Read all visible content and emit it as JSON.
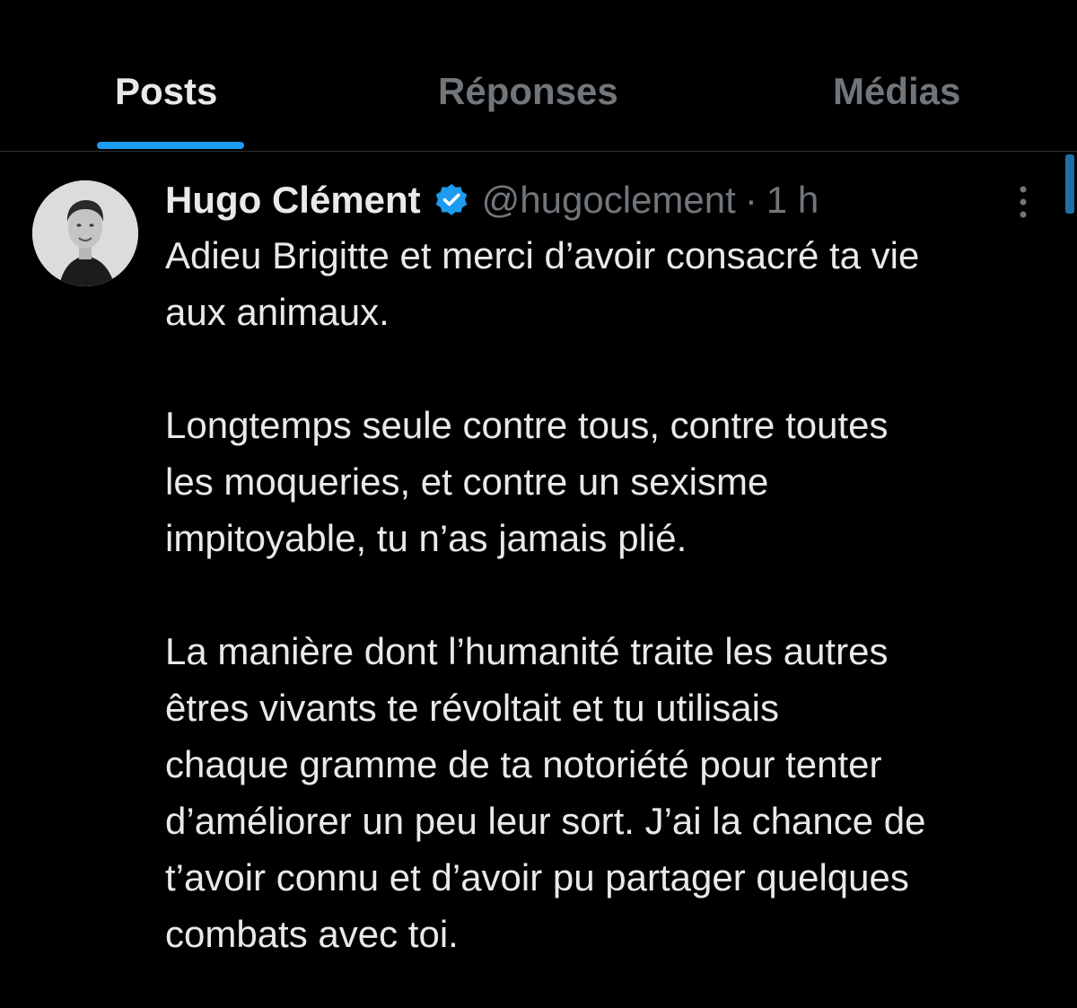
{
  "tabs": {
    "posts": "Posts",
    "replies": "Réponses",
    "media": "Médias",
    "active": "posts"
  },
  "post": {
    "author_name": "Hugo Clément",
    "handle": "@hugoclement",
    "separator": "·",
    "time": "1 h",
    "verified": true,
    "paragraphs": [
      [
        "Adieu Brigitte et merci d’avoir consacré ta vie",
        "aux animaux."
      ],
      [
        "Longtemps seule contre tous, contre toutes",
        "les moqueries, et contre un sexisme",
        "impitoyable, tu n’as jamais plié."
      ],
      [
        "La manière dont l’humanité traite les autres",
        "êtres vivants te révoltait et tu utilisais",
        "chaque gramme de ta notoriété pour tenter",
        "d’améliorer un peu leur sort. J’ai la chance de",
        "t’avoir connu et d’avoir pu partager quelques",
        "combats avec toi."
      ]
    ]
  },
  "colors": {
    "background": "#000000",
    "text_primary": "#e7e9ea",
    "text_secondary": "#71767b",
    "accent": "#1d9bf0",
    "divider": "#2f3336"
  },
  "icons": {
    "verified": "verified-badge-icon",
    "more": "more-vertical-icon"
  }
}
